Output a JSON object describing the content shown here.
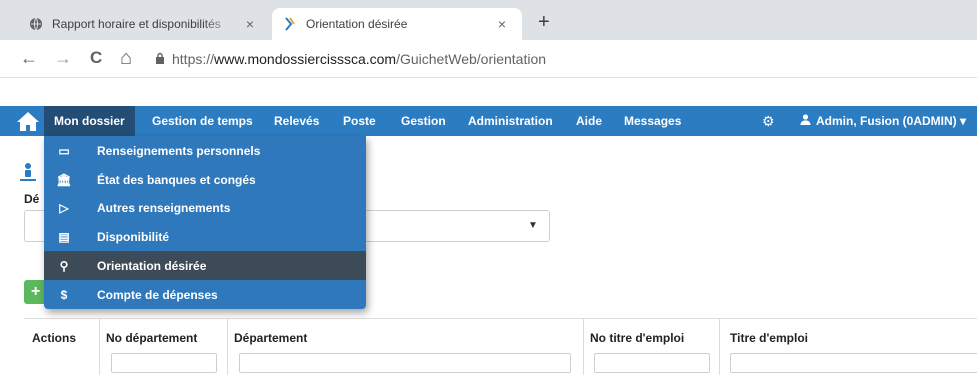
{
  "browser": {
    "tabs": [
      {
        "title": "Rapport horaire et disponibilités",
        "close": "×"
      },
      {
        "title": "Orientation désirée",
        "close": "×"
      }
    ],
    "new_tab": "+",
    "nav": {
      "back": "←",
      "forward": "→",
      "reload": "C",
      "home": "⌂"
    },
    "url": {
      "scheme": "https://",
      "host": "www.mondossiercisssca.com",
      "path": "/GuichetWeb/orientation"
    }
  },
  "navbar": {
    "items": [
      {
        "label": "Mon dossier"
      },
      {
        "label": "Gestion de temps"
      },
      {
        "label": "Relevés"
      },
      {
        "label": "Poste"
      },
      {
        "label": "Gestion"
      },
      {
        "label": "Administration"
      },
      {
        "label": "Aide"
      },
      {
        "label": "Messages"
      }
    ],
    "user": "Admin, Fusion (0ADMIN)",
    "user_caret": "▾"
  },
  "menu": {
    "items": [
      {
        "label": "Renseignements personnels",
        "icon": "id-card-icon",
        "glyph": "▭"
      },
      {
        "label": "État des banques et congés",
        "icon": "bank-icon",
        "glyph": "🏛"
      },
      {
        "label": "Autres renseignements",
        "icon": "folder-open-icon",
        "glyph": "▷"
      },
      {
        "label": "Disponibilité",
        "icon": "list-icon",
        "glyph": "▤"
      },
      {
        "label": "Orientation désirée",
        "icon": "compass-person-icon",
        "glyph": "⚲"
      },
      {
        "label": "Compte de dépenses",
        "icon": "dollar-icon",
        "glyph": "$"
      }
    ],
    "selected_index": 4
  },
  "page": {
    "dep_label": "Dé",
    "select_caret": "▼",
    "add_glyph": "+",
    "columns": [
      "Actions",
      "No département",
      "Département",
      "No titre d'emploi",
      "Titre d'emploi"
    ]
  },
  "colors": {
    "navbar": "#2c7cc1",
    "navbar_active": "#234d74",
    "menu": "#2f78bb",
    "menu_selected": "#3d4a57",
    "add_button": "#5cb85c"
  }
}
